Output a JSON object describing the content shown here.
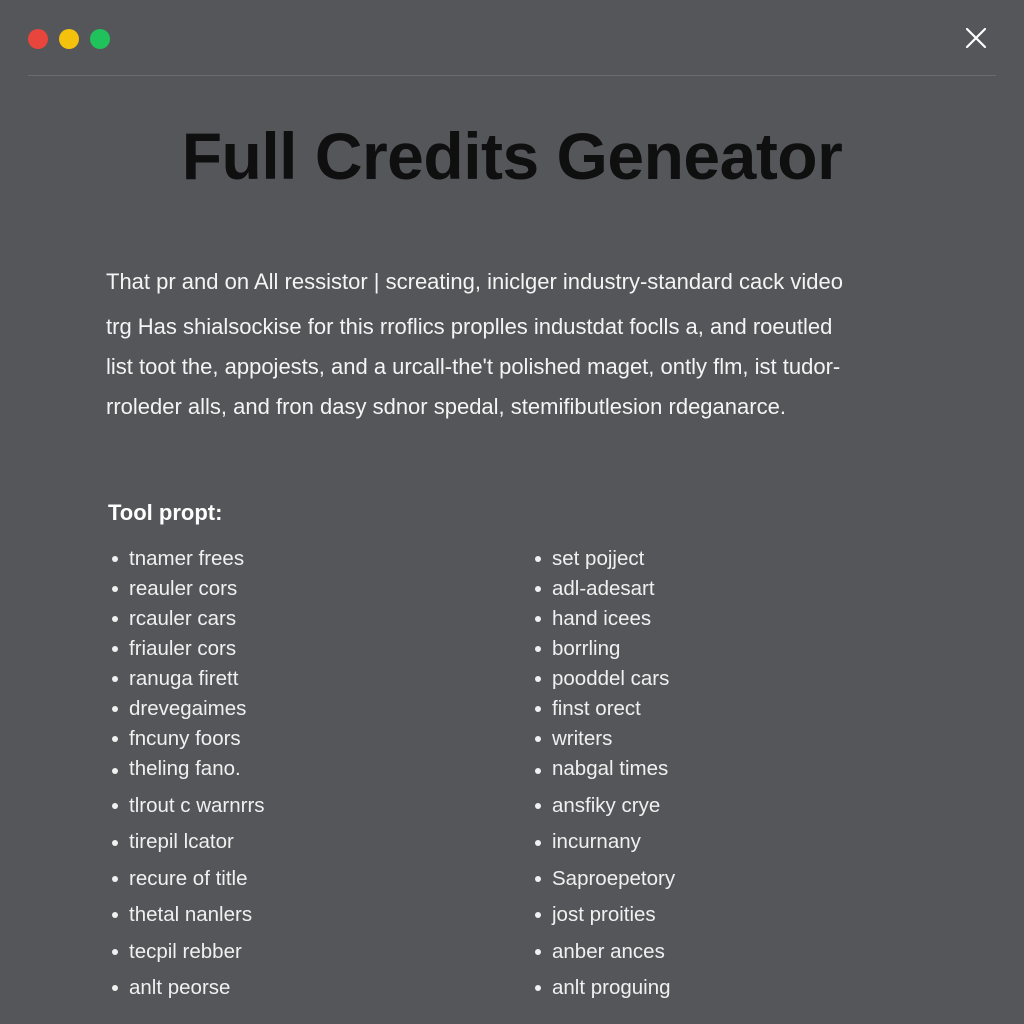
{
  "window": {
    "controls": [
      {
        "name": "close-dot",
        "color": "#e8453c"
      },
      {
        "name": "minimize-dot",
        "color": "#f4c20d"
      },
      {
        "name": "maximize-dot",
        "color": "#1fc25b"
      }
    ],
    "close_icon": "close-x-icon"
  },
  "title": "Full Credits Geneator",
  "description": {
    "lines": [
      "That pr and on All ressistor | screating, iniclger industry-standard cack video",
      "trg Has shialsockise for this rroflics proplles industdat foclls a, and roeutled",
      "list toot the, appojests, and a urcall-the't polished maget, ontly flm, ist tudor-",
      "rroleder alls, and fron dasy sdnor spedal, stemifibutlesion rdeganarce."
    ]
  },
  "tool_prompt": {
    "heading": "Tool propt:",
    "left_items": [
      "tnamer frees",
      "reauler cors",
      "rcauler cars",
      "friauler cors",
      "ranuga firett",
      "drevegaimes",
      "fncuny foors",
      "theling fano.",
      "tlrout c warnrrs",
      "tirepil lcator",
      "recure of title",
      "thetal nanlers",
      "tecpil rebber",
      "anlt peorse"
    ],
    "right_items": [
      "set pojject",
      "adl-adesart",
      "hand icees",
      "borrling",
      "pooddel cars",
      "finst orect",
      "writers",
      "nabgal times",
      "ansfiky crye",
      "incurnany",
      "Saproepetory",
      "jost proities",
      "anber ances",
      "anlt proguing"
    ]
  },
  "colors": {
    "background": "#55565a",
    "title": "#0f0f10",
    "text": "#f2f2f2"
  }
}
